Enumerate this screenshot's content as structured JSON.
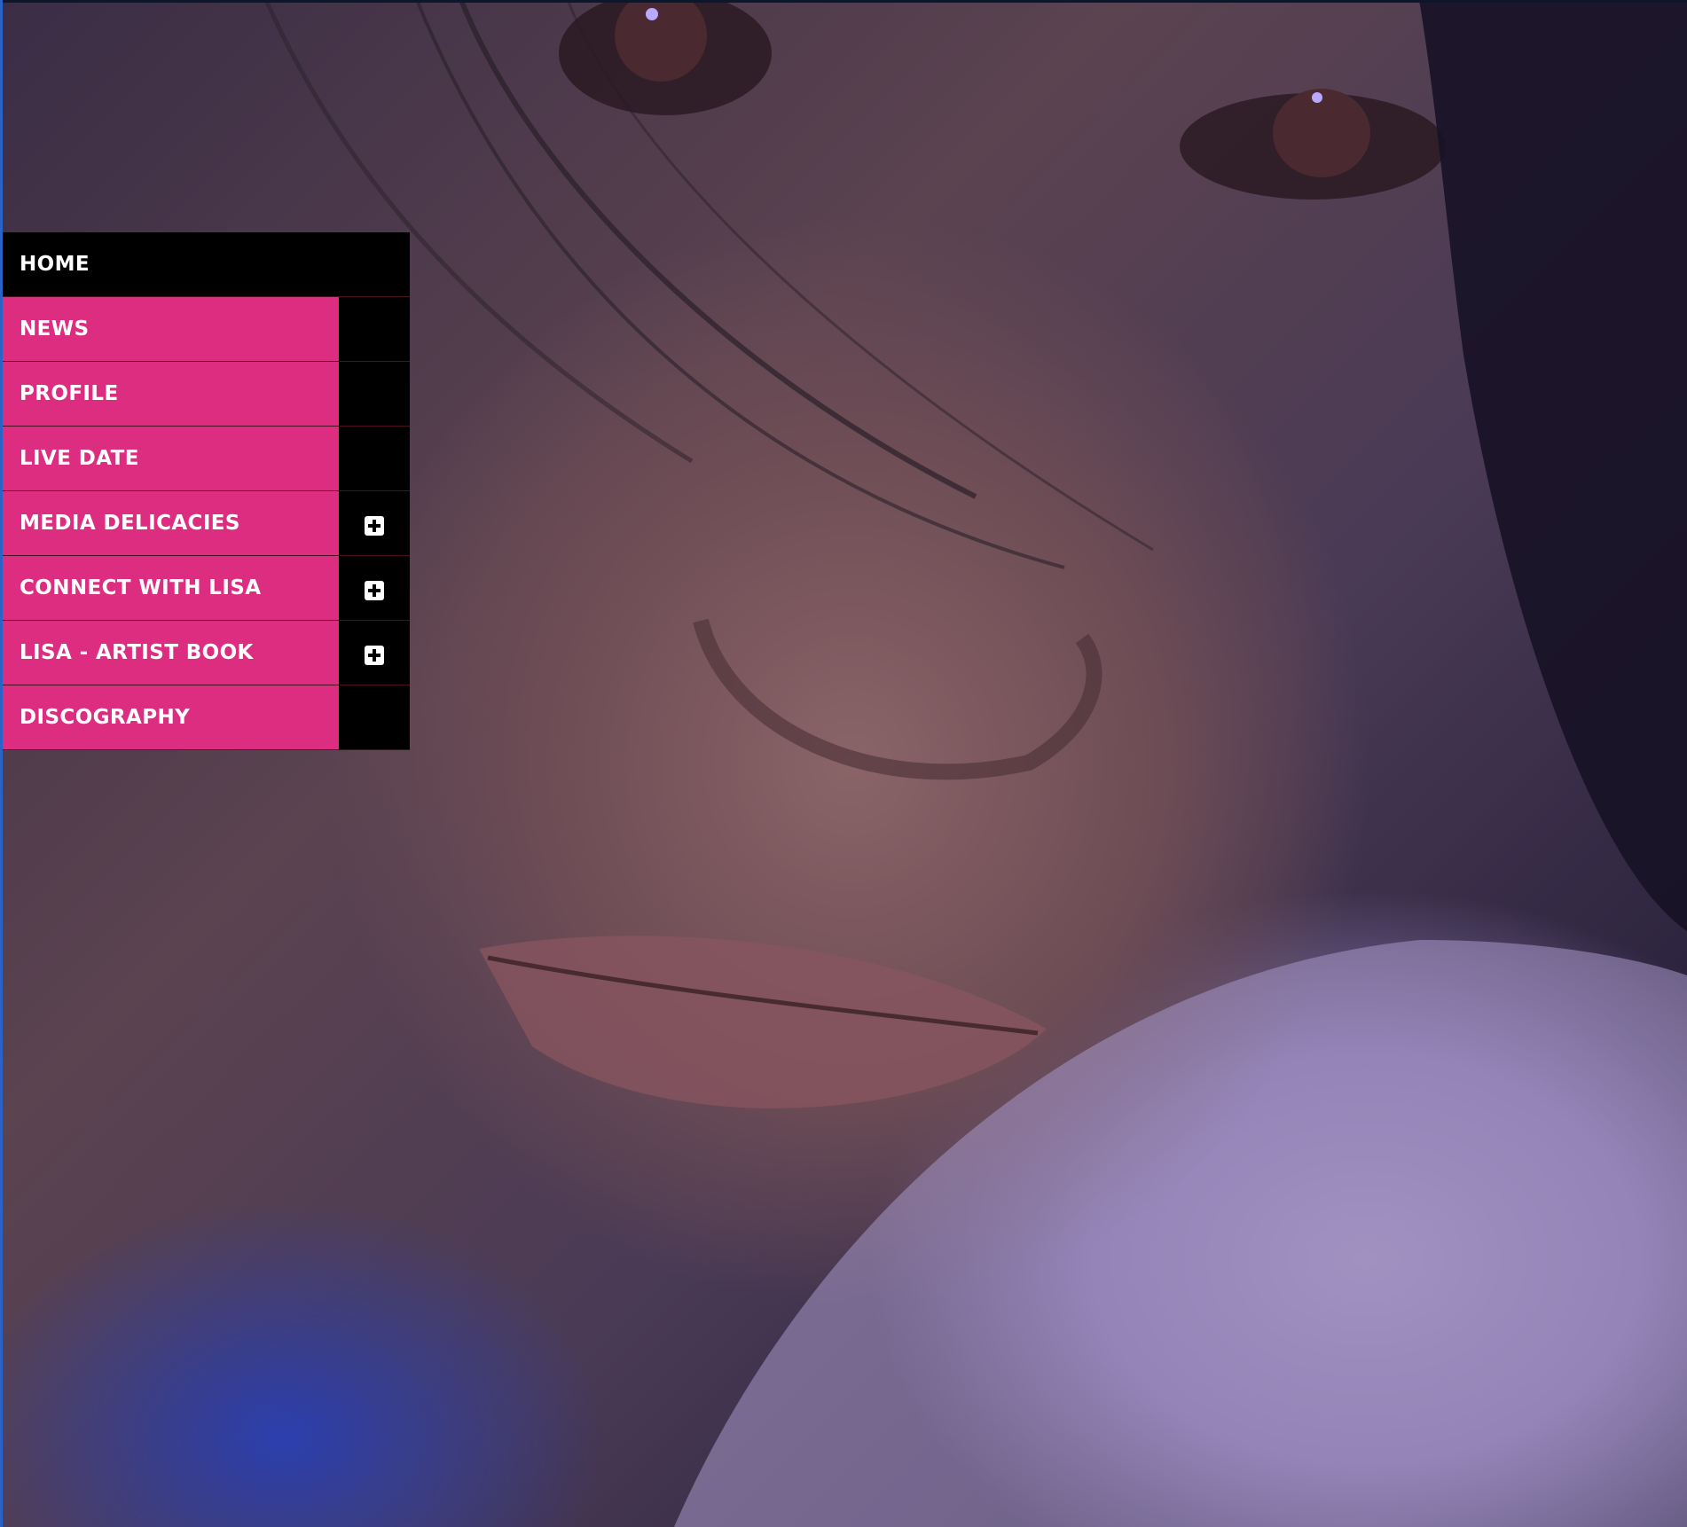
{
  "background": {
    "image": "artist-closeup-photo"
  },
  "nav": {
    "items": [
      {
        "label": "HOME",
        "active": true,
        "expandable": false
      },
      {
        "label": "NEWS",
        "active": false,
        "expandable": false
      },
      {
        "label": "PROFILE",
        "active": false,
        "expandable": false
      },
      {
        "label": "LIVE DATE",
        "active": false,
        "expandable": false
      },
      {
        "label": "MEDIA DELICACIES",
        "active": false,
        "expandable": true,
        "icon": "plus-icon"
      },
      {
        "label": "CONNECT WITH LISA",
        "active": false,
        "expandable": true,
        "icon": "plus-icon"
      },
      {
        "label": "LISA - ARTIST BOOK",
        "active": false,
        "expandable": true,
        "icon": "plus-icon"
      },
      {
        "label": "DISCOGRAPHY",
        "active": false,
        "expandable": false
      }
    ]
  },
  "colors": {
    "menu_pink": "#dd2d80",
    "menu_black": "#000000",
    "menu_text": "#ffffff"
  }
}
